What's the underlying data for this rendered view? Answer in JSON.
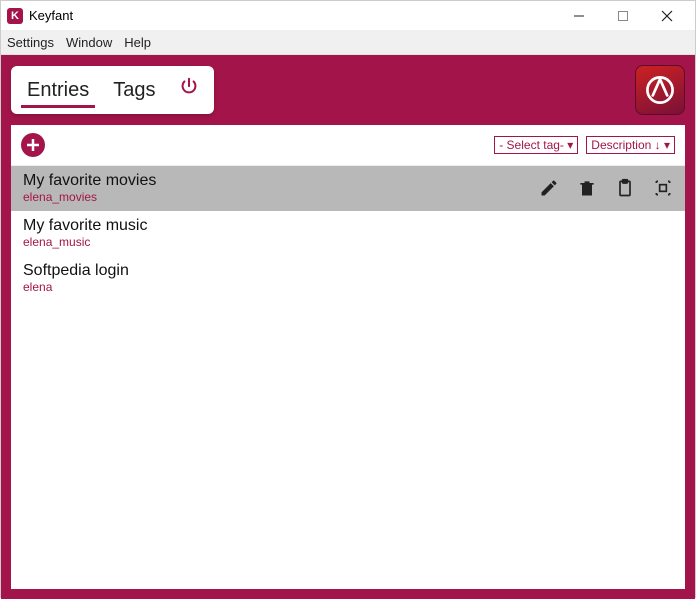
{
  "window": {
    "title": "Keyfant"
  },
  "menu": {
    "settings": "Settings",
    "window": "Window",
    "help": "Help"
  },
  "tabs": {
    "entries": "Entries",
    "tags": "Tags"
  },
  "filters": {
    "tag_select": "- Select tag- ▾",
    "sort": "Description ↓ ▾"
  },
  "entries": [
    {
      "title": "My favorite movies",
      "user": "elena_movies",
      "selected": true
    },
    {
      "title": "My favorite music",
      "user": "elena_music",
      "selected": false
    },
    {
      "title": "Softpedia login",
      "user": "elena",
      "selected": false
    }
  ]
}
